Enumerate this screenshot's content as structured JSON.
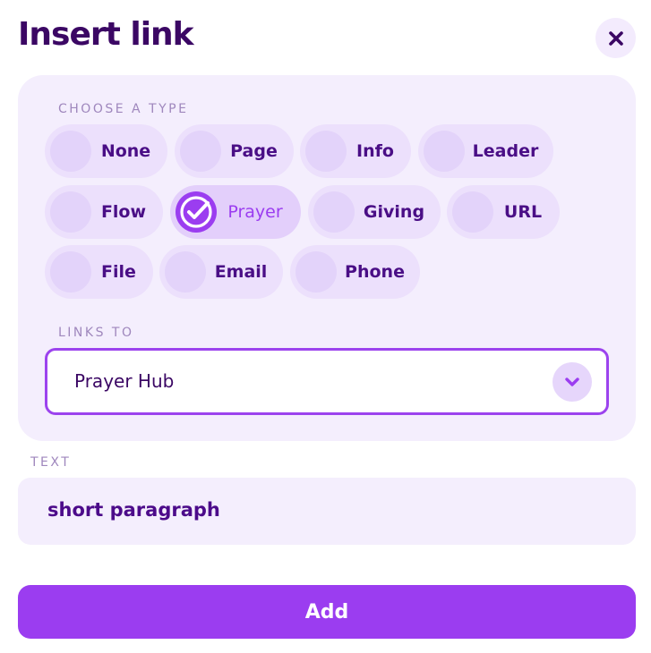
{
  "dialog": {
    "title": "Insert link"
  },
  "type_section": {
    "label": "CHOOSE A TYPE",
    "options": [
      {
        "label": "None",
        "selected": false
      },
      {
        "label": "Page",
        "selected": false
      },
      {
        "label": "Info",
        "selected": false
      },
      {
        "label": "Leader",
        "selected": false
      },
      {
        "label": "Flow",
        "selected": false
      },
      {
        "label": "Prayer",
        "selected": true
      },
      {
        "label": "Giving",
        "selected": false
      },
      {
        "label": "URL",
        "selected": false
      },
      {
        "label": "File",
        "selected": false
      },
      {
        "label": "Email",
        "selected": false
      },
      {
        "label": "Phone",
        "selected": false
      }
    ]
  },
  "links_to": {
    "label": "LINKS TO",
    "value": "Prayer Hub"
  },
  "text": {
    "label": "TEXT",
    "value": "short paragraph"
  },
  "actions": {
    "add_label": "Add"
  },
  "colors": {
    "accent": "#9b3df0",
    "title": "#3b0764",
    "panel_bg": "#f4eefd"
  },
  "icons": [
    "close-icon",
    "check-circle-icon",
    "chevron-down-icon"
  ]
}
